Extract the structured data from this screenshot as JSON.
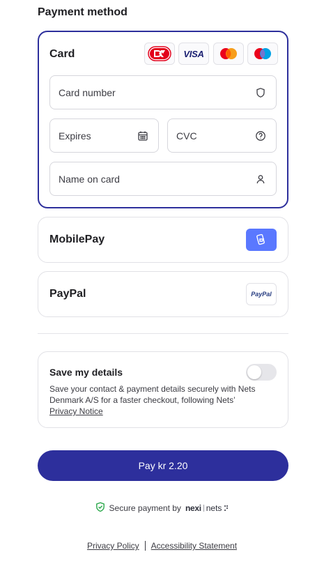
{
  "section_title": "Payment method",
  "card": {
    "title": "Card",
    "logos": [
      "dankort-icon",
      "visa-icon",
      "mastercard-icon",
      "maestro-icon"
    ],
    "visa_text": "VISA",
    "fields": {
      "card_number_placeholder": "Card number",
      "expires_placeholder": "Expires",
      "cvc_placeholder": "CVC",
      "name_placeholder": "Name on card"
    }
  },
  "methods": {
    "mobilepay": "MobilePay",
    "paypal": "PayPal",
    "paypal_logo_text": "PayPal"
  },
  "save": {
    "title": "Save my details",
    "description": "Save your contact & payment details securely with Nets Denmark A/S for a faster checkout, following Nets’ ",
    "privacy_link": "Privacy Notice",
    "toggle_on": false
  },
  "pay_button": "Pay kr 2.20",
  "secure": {
    "text": "Secure payment by",
    "brand_nexi": "nexi",
    "brand_nets": "nets"
  },
  "footer": {
    "privacy": "Privacy Policy",
    "accessibility": "Accessibility Statement"
  },
  "colors": {
    "accent": "#2d2f9c",
    "mobilepay": "#5a78ff",
    "secure_icon": "#2aa84a"
  }
}
